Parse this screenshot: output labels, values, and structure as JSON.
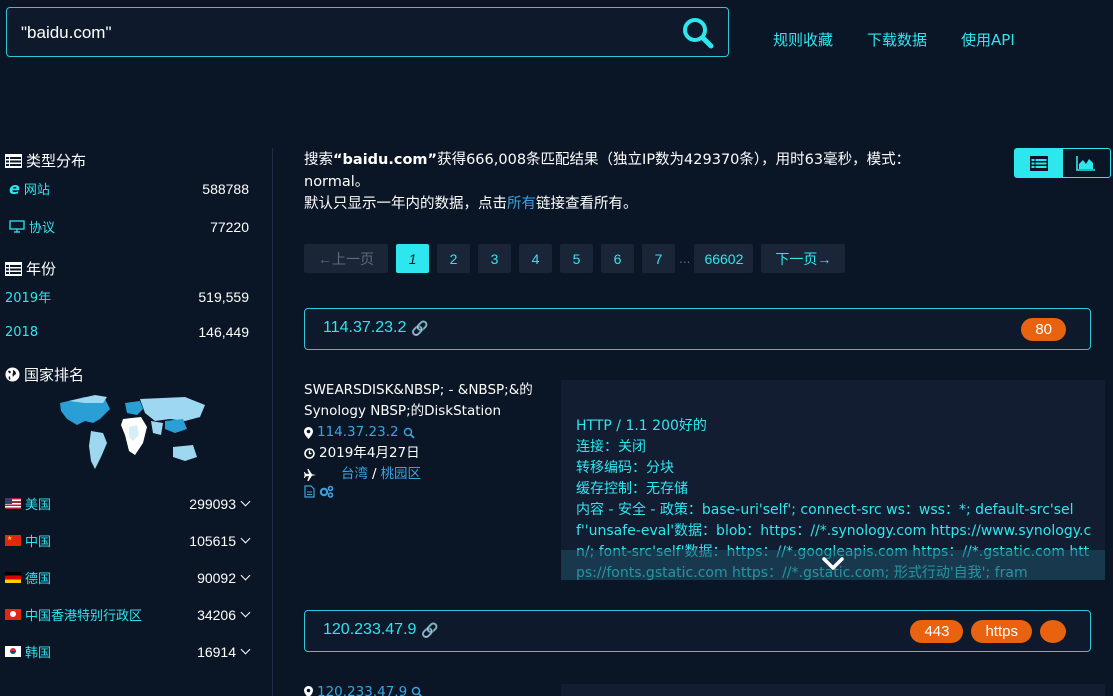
{
  "search": {
    "query": "\"baidu.com\""
  },
  "top_nav": [
    "规则收藏",
    "下载数据",
    "使用API"
  ],
  "sidebar": {
    "type_section": {
      "title": "类型分布",
      "items": [
        {
          "label": "网站",
          "count": "588788",
          "icon": "e-icon"
        },
        {
          "label": "协议",
          "count": "77220",
          "icon": "monitor-icon"
        }
      ]
    },
    "year_section": {
      "title": "年份",
      "items": [
        {
          "label": "2019年",
          "count": "519,559"
        },
        {
          "label": "2018",
          "count": "146,449"
        }
      ]
    },
    "country_section": {
      "title": "国家排名",
      "items": [
        {
          "label": "美国",
          "count": "299093",
          "flag": "us"
        },
        {
          "label": "中国",
          "count": "105615",
          "flag": "cn"
        },
        {
          "label": "德国",
          "count": "90092",
          "flag": "de"
        },
        {
          "label": "中国香港特别行政区",
          "count": "34206",
          "flag": "hk"
        },
        {
          "label": "韩国",
          "count": "16914",
          "flag": "kr"
        }
      ]
    }
  },
  "summary": {
    "prefix": "搜索",
    "query": "“baidu.com”",
    "rest": "获得666,008条匹配结果（独立IP数为429370条），用时63毫秒，模式：normal。",
    "line2_a": "默认只显示一年内的数据，点击",
    "line2_link": "所有",
    "line2_b": "链接查看所有。"
  },
  "pagination": {
    "prev": "←上一页",
    "pages": [
      "1",
      "2",
      "3",
      "4",
      "5",
      "6",
      "7"
    ],
    "ellipsis": "...",
    "last": "66602",
    "next": "下一页→"
  },
  "results": [
    {
      "ip": "114.37.23.2",
      "ports": [
        "80"
      ],
      "title": "SWEARSDISK&NBSP; - &NBSP;&的Synology NBSP;的DiskStation",
      "ip_small": "114.37.23.2",
      "date": "2019年4月27日",
      "location_a": "台湾",
      "location_sep": "/",
      "location_b": "桃园区",
      "banner_lines": [
        "HTTP / 1.1 200好的",
        "连接：关闭",
        "转移编码：分块",
        "缓存控制：无存储",
        "内容 - 安全 - 政策：base-uri'self'; connect-src ws：wss：*; default-src'self''unsafe-eval'数据：blob：https：//*.synology.com https://www.synology.cn/; font-src'self'数据：https：//*.googleapis.com https：//*.gstatic.com https://fonts.gstatic.com https：//*.gstatic.com; 形式行动'自我'; fram"
      ]
    },
    {
      "ip": "120.233.47.9",
      "ports": [
        "443",
        "https",
        ""
      ],
      "ip_small": "120.233.47.9"
    }
  ],
  "colors": {
    "accent": "#2ee6ee",
    "badge": "#e8620f",
    "bg": "#0a1526"
  }
}
